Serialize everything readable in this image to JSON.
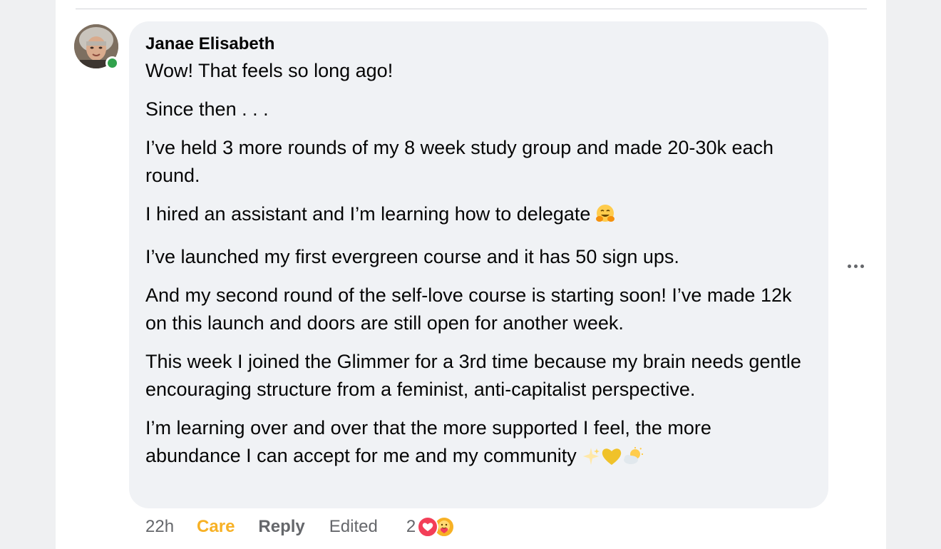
{
  "comment": {
    "author": "Janae Elisabeth",
    "paragraphs": [
      "Wow! That feels so long ago!",
      "Since then . . .",
      "I’ve held 3 more rounds of my 8 week study group and made 20-30k each round.",
      "I hired an assistant and I’m learning how to delegate",
      "I’ve launched my first evergreen course and it has 50 sign ups.",
      "And my second round of the self-love course is starting soon! I’ve made 12k on this launch and doors are still open for another week.",
      "This week I joined the Glimmer for a 3rd time because my brain needs gentle encouraging structure from a feminist, anti-capitalist perspective.",
      "I’m learning over and over that the more supported I feel, the more abundance I can accept for me and my community"
    ],
    "time": "22h",
    "reaction_label": "Care",
    "reply_label": "Reply",
    "edited_label": "Edited",
    "reaction_count": "2",
    "reaction_icons": [
      "love-icon",
      "care-icon"
    ],
    "inline_emojis": [
      "hugging-face-emoji",
      "sparkles-emoji",
      "yellow-heart-emoji",
      "sun-behind-cloud-emoji"
    ]
  },
  "colors": {
    "care_accent": "#f7b125",
    "love": "#f33e58",
    "online": "#31a24c",
    "bubble": "#f0f2f5",
    "meta_text": "#65676b"
  }
}
